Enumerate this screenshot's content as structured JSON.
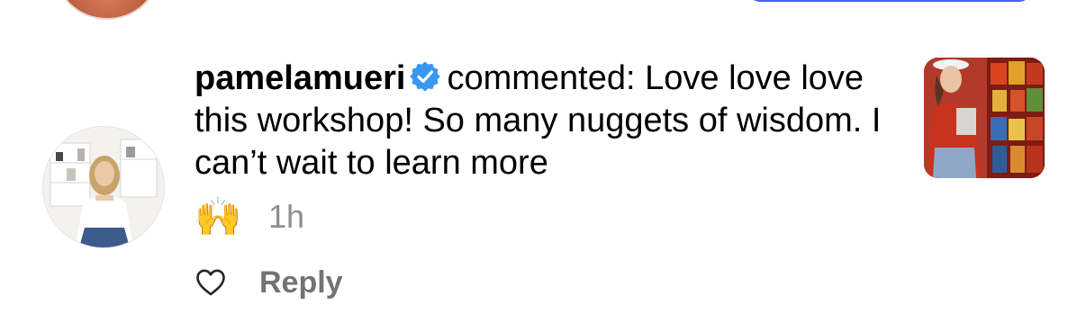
{
  "comment": {
    "username": "pamelamueri",
    "verified_icon": "verified-badge-icon",
    "text": "commented: Love love love this workshop! So many nuggets of wisdom. I can’t wait to learn more",
    "emoji": "🙌",
    "timestamp": "1h"
  },
  "actions": {
    "like_icon": "heart-icon",
    "reply_label": "Reply"
  },
  "icons": {
    "avatar": "user-avatar",
    "thumbnail": "post-thumbnail"
  },
  "colors": {
    "verified": "#3897f0",
    "secondary_text": "#8e8e8e",
    "reply": "#737373"
  }
}
